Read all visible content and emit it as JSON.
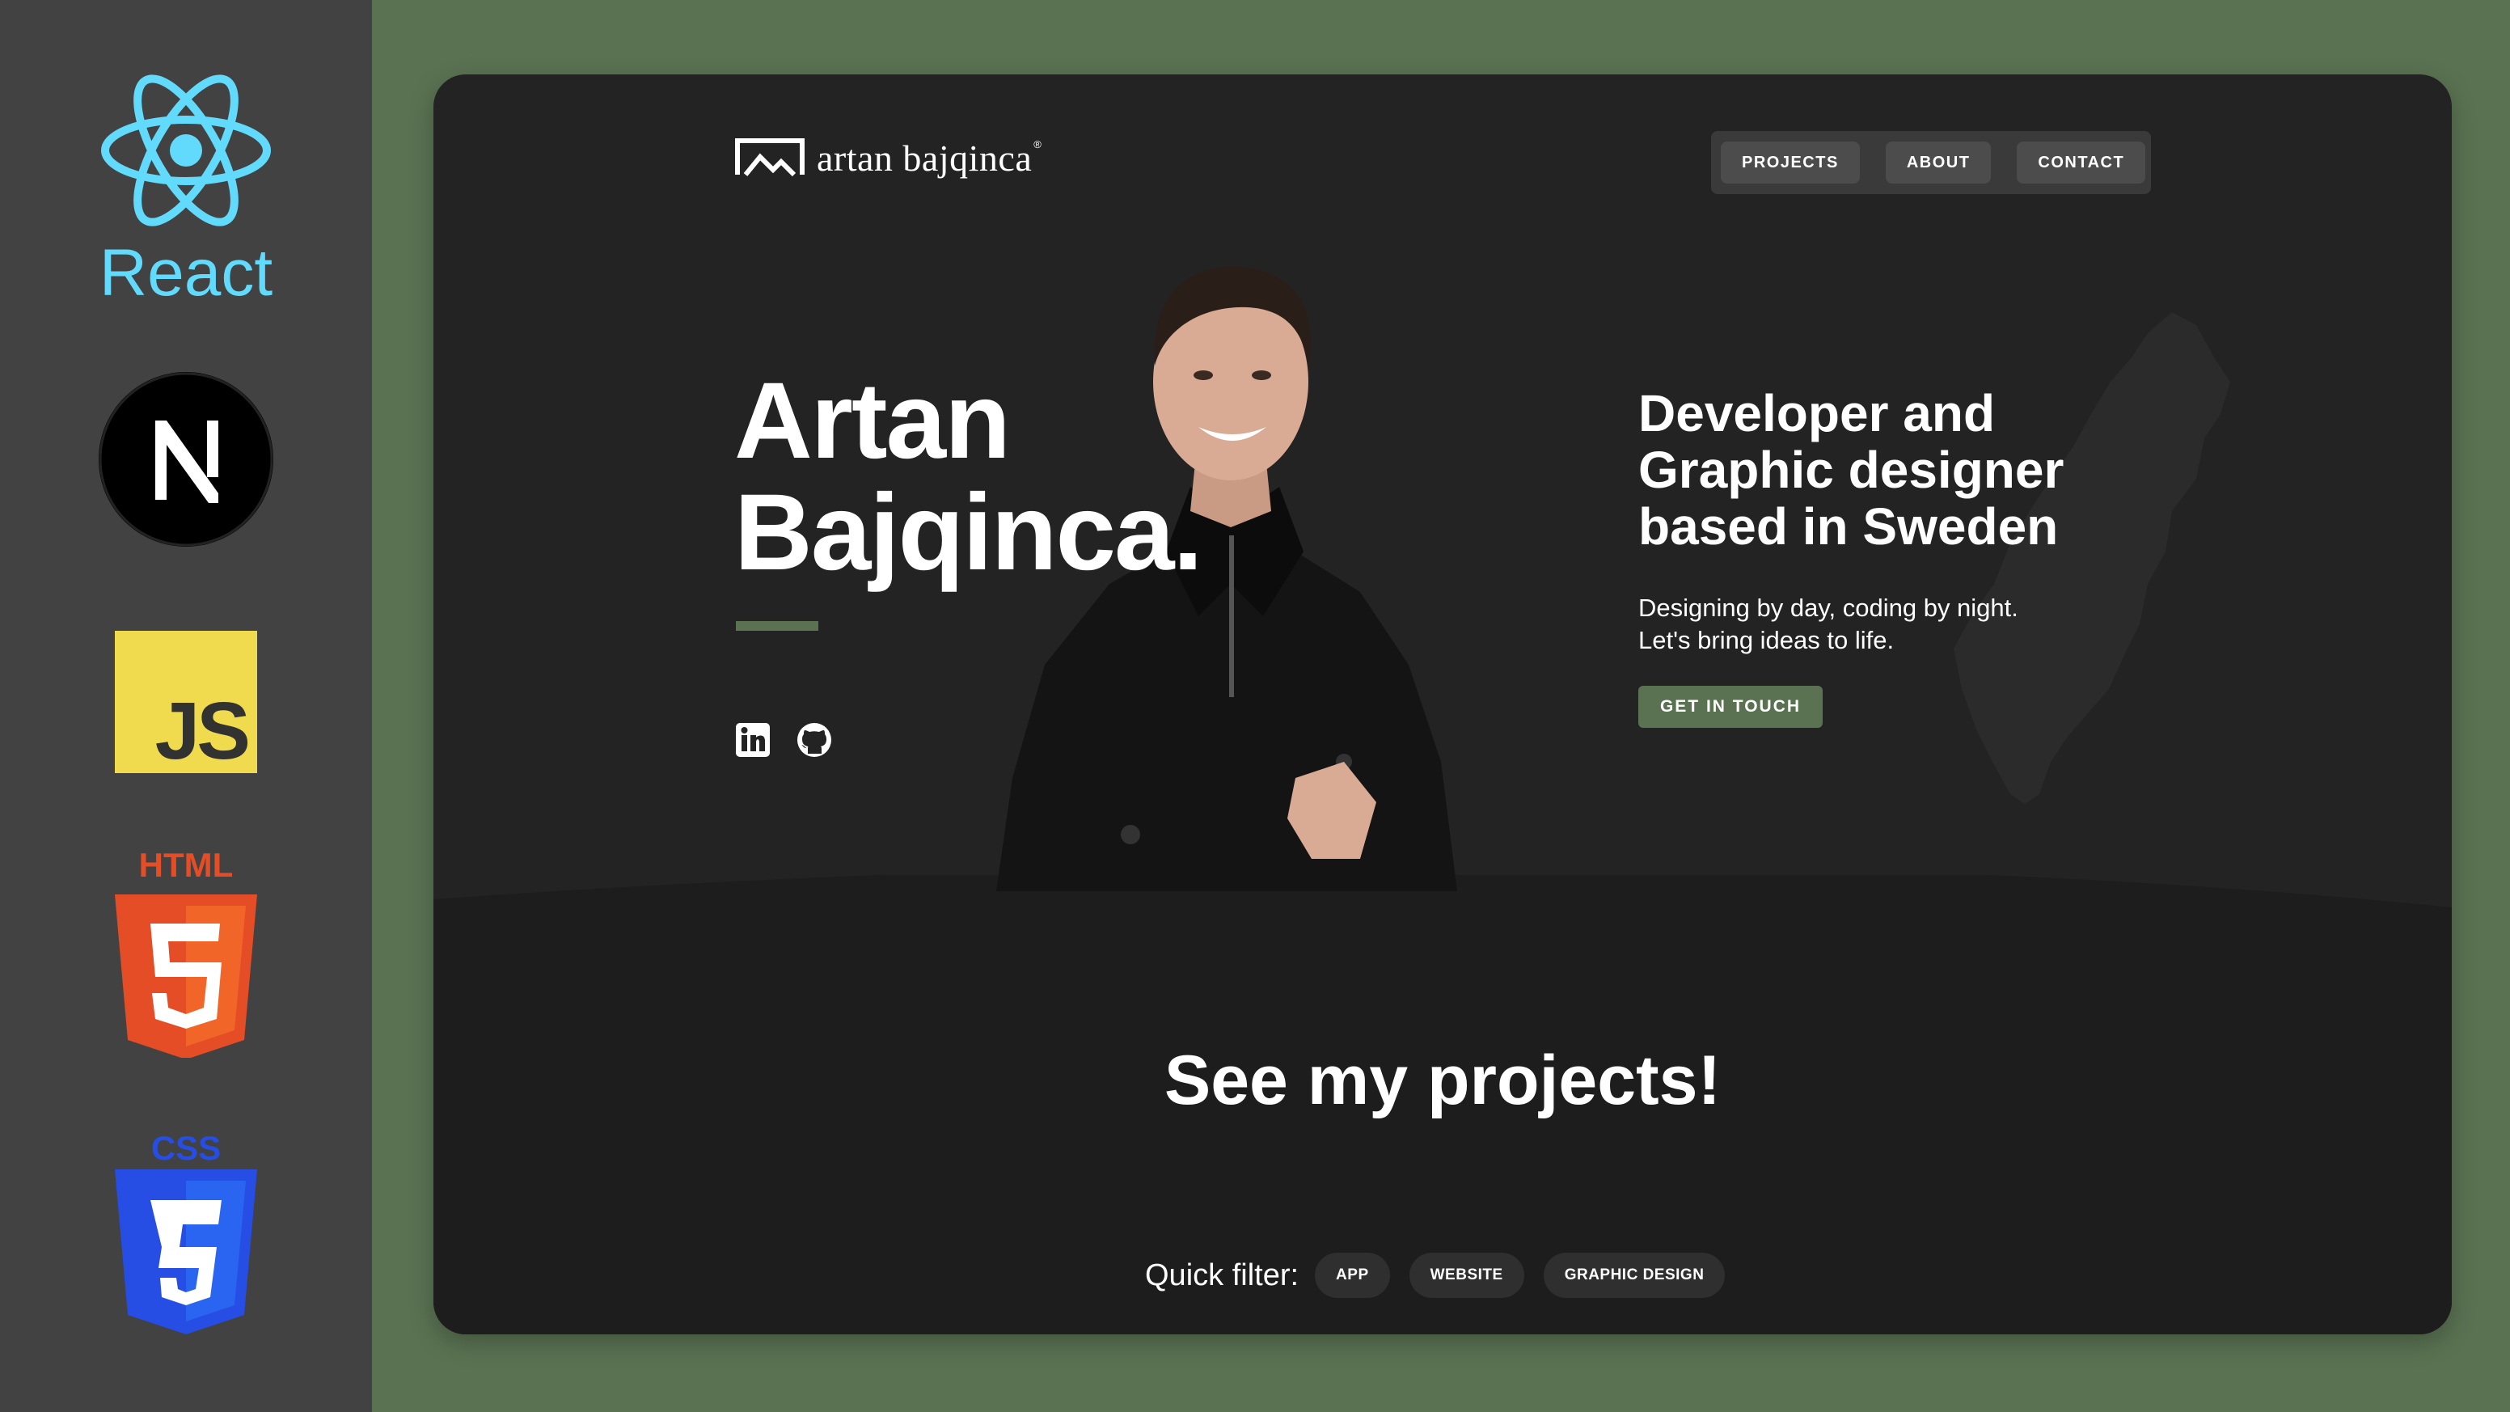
{
  "sidebar": {
    "logos": [
      {
        "name": "React",
        "label": "React",
        "color": "#61dafb"
      },
      {
        "name": "Next.js",
        "label": "N",
        "color": "#000000"
      },
      {
        "name": "JavaScript",
        "label": "JS",
        "color": "#f0db4f"
      },
      {
        "name": "HTML5",
        "label": "HTML",
        "color": "#e44d26"
      },
      {
        "name": "CSS3",
        "label": "CSS",
        "color": "#264de4"
      }
    ]
  },
  "header": {
    "brand": "artan bajqinca",
    "brand_mark": "registered-mark",
    "nav": [
      "PROJECTS",
      "ABOUT",
      "CONTACT"
    ]
  },
  "hero": {
    "name_line1": "Artan",
    "name_line2": "Bajqinca.",
    "socials": [
      "linkedin-icon",
      "github-icon"
    ],
    "tagline": [
      "Developer and",
      "Graphic designer",
      "based in Sweden"
    ],
    "intro": [
      "Designing by day, coding by night.",
      "Let's bring ideas to life."
    ],
    "cta": "GET IN TOUCH"
  },
  "projects": {
    "heading": "See my projects!",
    "filter_label": "Quick filter:",
    "filters": [
      "APP",
      "WEBSITE",
      "GRAPHIC DESIGN"
    ]
  },
  "colors": {
    "accent": "#5a7252",
    "background": "#232323",
    "sidebar": "#424242"
  }
}
